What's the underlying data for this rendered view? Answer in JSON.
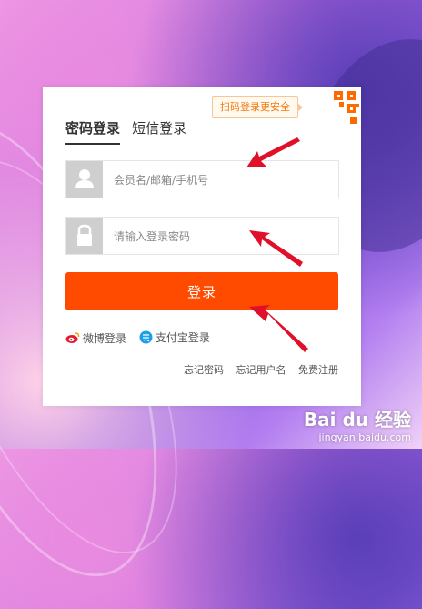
{
  "qr_tip": "扫码登录更安全",
  "tabs": [
    {
      "label": "密码登录",
      "active": true
    },
    {
      "label": "短信登录",
      "active": false
    }
  ],
  "username": {
    "placeholder": "会员名/邮箱/手机号",
    "value": ""
  },
  "password": {
    "placeholder": "请输入登录密码",
    "value": ""
  },
  "login_button": "登录",
  "third_party": [
    {
      "label": "微博登录",
      "icon": "weibo-icon"
    },
    {
      "label": "支付宝登录",
      "icon": "alipay-icon"
    }
  ],
  "footer_links": [
    "忘记密码",
    "忘记用户名",
    "免费注册"
  ],
  "watermark": {
    "main": "Bai du 经验",
    "sub": "jingyan.baidu.com"
  },
  "colors": {
    "accent": "#ff4b00",
    "tip_text": "#f07a12",
    "arrow": "#e0102a"
  }
}
